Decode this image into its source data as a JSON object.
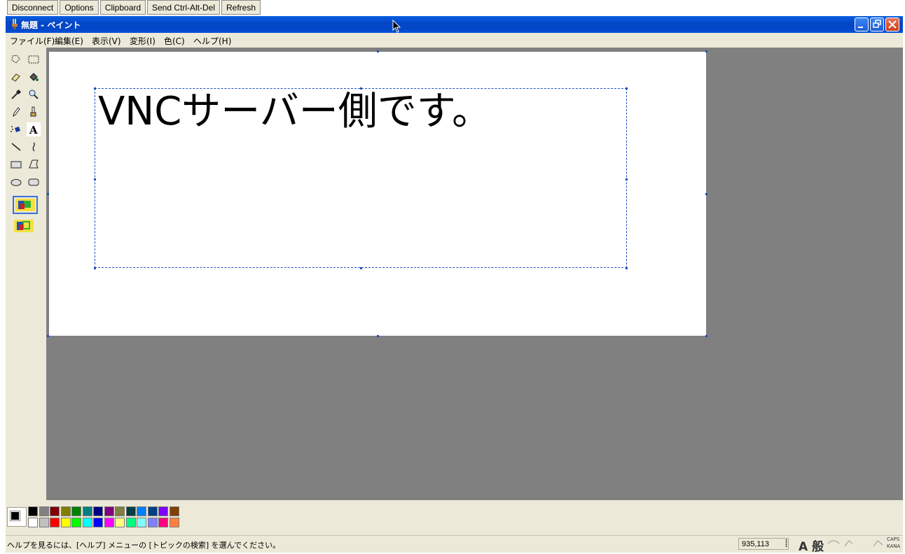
{
  "vnc_toolbar": {
    "buttons": [
      {
        "label": "Disconnect"
      },
      {
        "label": "Options"
      },
      {
        "label": "Clipboard"
      },
      {
        "label": "Send Ctrl-Alt-Del"
      },
      {
        "label": "Refresh"
      }
    ]
  },
  "window": {
    "title": "無題 - ペイント",
    "icon": "paint-app-icon"
  },
  "menu": {
    "items": [
      {
        "label": "ファイル(F)"
      },
      {
        "label": "編集(E)"
      },
      {
        "label": "表示(V)"
      },
      {
        "label": "変形(I)"
      },
      {
        "label": "色(C)"
      },
      {
        "label": "ヘルプ(H)"
      }
    ]
  },
  "tools": [
    "free-select-icon",
    "rect-select-icon",
    "eraser-icon",
    "fill-icon",
    "color-picker-icon",
    "magnifier-icon",
    "pencil-icon",
    "brush-icon",
    "airbrush-icon",
    "text-icon",
    "line-icon",
    "curve-icon",
    "rectangle-icon",
    "polygon-icon",
    "ellipse-icon",
    "rounded-rect-icon"
  ],
  "active_tool": "text-icon",
  "canvas": {
    "text": "VNCサーバー側です。"
  },
  "palette": {
    "foreground": "#000000",
    "background": "#ffffff",
    "row1": [
      "#000000",
      "#808080",
      "#800000",
      "#808000",
      "#008000",
      "#008080",
      "#000080",
      "#800080",
      "#808040",
      "#004040",
      "#0080ff",
      "#004080",
      "#8000ff",
      "#804000"
    ],
    "row2": [
      "#ffffff",
      "#c0c0c0",
      "#ff0000",
      "#ffff00",
      "#00ff00",
      "#00ffff",
      "#0000ff",
      "#ff00ff",
      "#ffff80",
      "#00ff80",
      "#80ffff",
      "#8080ff",
      "#ff0080",
      "#ff8040"
    ]
  },
  "status": {
    "help_text": "ヘルプを見るには、[ヘルプ] メニューの [トピックの検索] を選んでください。",
    "coordinates": "935,113",
    "ime_mode": "A 般",
    "caps_label": "CAPS",
    "kana_label": "KANA"
  }
}
